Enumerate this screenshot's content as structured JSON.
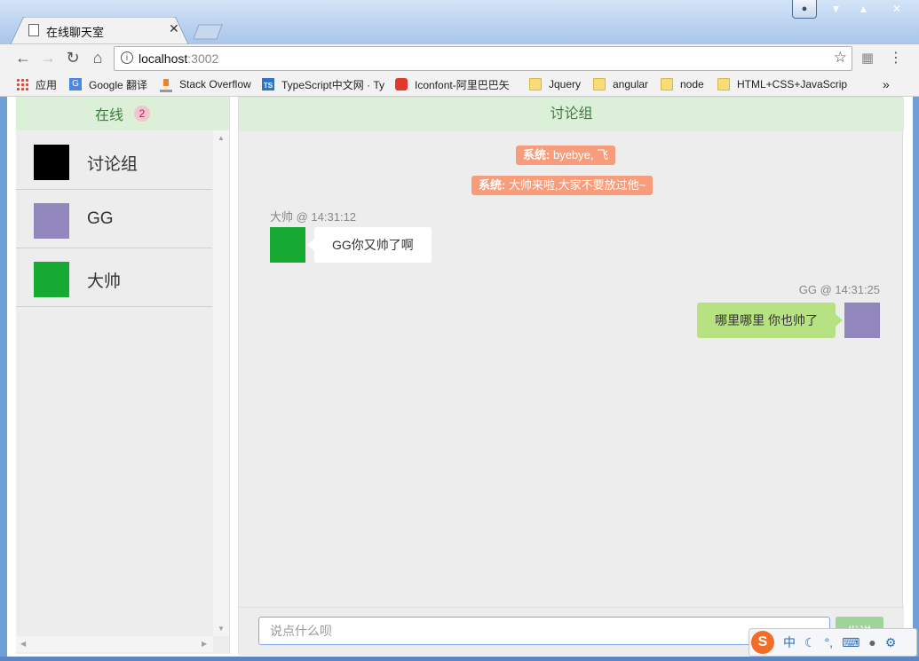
{
  "browser": {
    "tab_title": "在线聊天室",
    "url_host": "localhost",
    "url_port": ":3002",
    "bookmarks": [
      {
        "label": "应用",
        "icon": "apps-grid-icon"
      },
      {
        "label": "Google 翻译",
        "icon": "google-translate-icon"
      },
      {
        "label": "Stack Overflow",
        "icon": "stack-overflow-icon"
      },
      {
        "label": "TypeScript中文网 · Ty",
        "icon": "typescript-icon"
      },
      {
        "label": "Iconfont-阿里巴巴矢",
        "icon": "iconfont-icon"
      },
      {
        "label": "Jquery",
        "icon": "folder-icon"
      },
      {
        "label": "angular",
        "icon": "folder-icon"
      },
      {
        "label": "node",
        "icon": "folder-icon"
      },
      {
        "label": "HTML+CSS+JavaScrip",
        "icon": "folder-icon"
      }
    ],
    "overflow": "»"
  },
  "sidebar": {
    "title": "在线",
    "online_count": "2",
    "users": [
      {
        "name": "讨论组",
        "color": "#000000"
      },
      {
        "name": "GG",
        "color": "#9287bd"
      },
      {
        "name": "大帅",
        "color": "#17aa33"
      }
    ]
  },
  "chat": {
    "title": "讨论组",
    "system_messages": [
      {
        "prefix": "系统:",
        "text": "byebye, 飞"
      },
      {
        "prefix": "系统:",
        "text": "大帅来啦,大家不要放过他~"
      }
    ],
    "messages": [
      {
        "meta": "大帅 @ 14:31:12",
        "text": "GG你又帅了啊",
        "side": "left",
        "color": "#17aa33"
      },
      {
        "meta": "GG @ 14:31:25",
        "text": "哪里哪里 你也帅了",
        "side": "right",
        "color": "#9287bd"
      }
    ],
    "input_placeholder": "说点什么呗",
    "send_label": "发送"
  },
  "ime": {
    "mode": "中"
  }
}
